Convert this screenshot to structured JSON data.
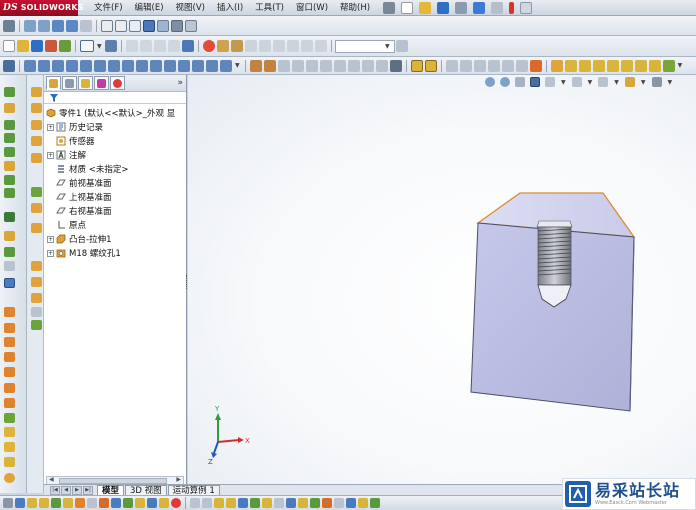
{
  "app": {
    "logo_text": "SOLIDWORKS",
    "logo_mark": "DS"
  },
  "menu": [
    {
      "label": "文件(F)",
      "name": "menu-file"
    },
    {
      "label": "编辑(E)",
      "name": "menu-edit"
    },
    {
      "label": "视图(V)",
      "name": "menu-view"
    },
    {
      "label": "插入(I)",
      "name": "menu-insert"
    },
    {
      "label": "工具(T)",
      "name": "menu-tools"
    },
    {
      "label": "窗口(W)",
      "name": "menu-window"
    },
    {
      "label": "帮助(H)",
      "name": "menu-help"
    }
  ],
  "feature_tree": {
    "tabs": [
      "feature-manager-tab",
      "property-manager-tab",
      "configuration-manager-tab",
      "dimxpert-tab",
      "display-manager-tab"
    ],
    "collapse_glyph": "»",
    "root": "零件1 (默认<<默认>_外观 显",
    "items": [
      {
        "label": "历史记录",
        "icon": "history-icon",
        "expandable": true
      },
      {
        "label": "传感器",
        "icon": "sensor-icon",
        "expandable": false
      },
      {
        "label": "注解",
        "icon": "annotation-icon",
        "expandable": true
      },
      {
        "label": "材质 <未指定>",
        "icon": "material-icon",
        "expandable": false
      },
      {
        "label": "前视基准面",
        "icon": "plane-icon",
        "expandable": false
      },
      {
        "label": "上视基准面",
        "icon": "plane-icon",
        "expandable": false
      },
      {
        "label": "右视基准面",
        "icon": "plane-icon",
        "expandable": false
      },
      {
        "label": "原点",
        "icon": "origin-icon",
        "expandable": false
      },
      {
        "label": "凸台-拉伸1",
        "icon": "extrude-icon",
        "expandable": true
      },
      {
        "label": "M18 螺纹孔1",
        "icon": "hole-wizard-icon",
        "expandable": true
      }
    ]
  },
  "bottom_tabs": [
    {
      "label": "模型",
      "active": true
    },
    {
      "label": "3D 视图",
      "active": false
    },
    {
      "label": "运动算例 1",
      "active": false
    }
  ],
  "triad": {
    "x": "X",
    "y": "Y",
    "z": "Z"
  },
  "watermark": {
    "text": "易采站长站",
    "sub": "Www.Easck.Com Webmaster"
  },
  "colors": {
    "part_face": "#c9cbe8",
    "part_face_shade": "#b5b8dc",
    "selected_edge": "#e08a2e",
    "triad_x": "#d32f2f",
    "triad_y": "#2e9b3c",
    "triad_z": "#2454c8"
  }
}
